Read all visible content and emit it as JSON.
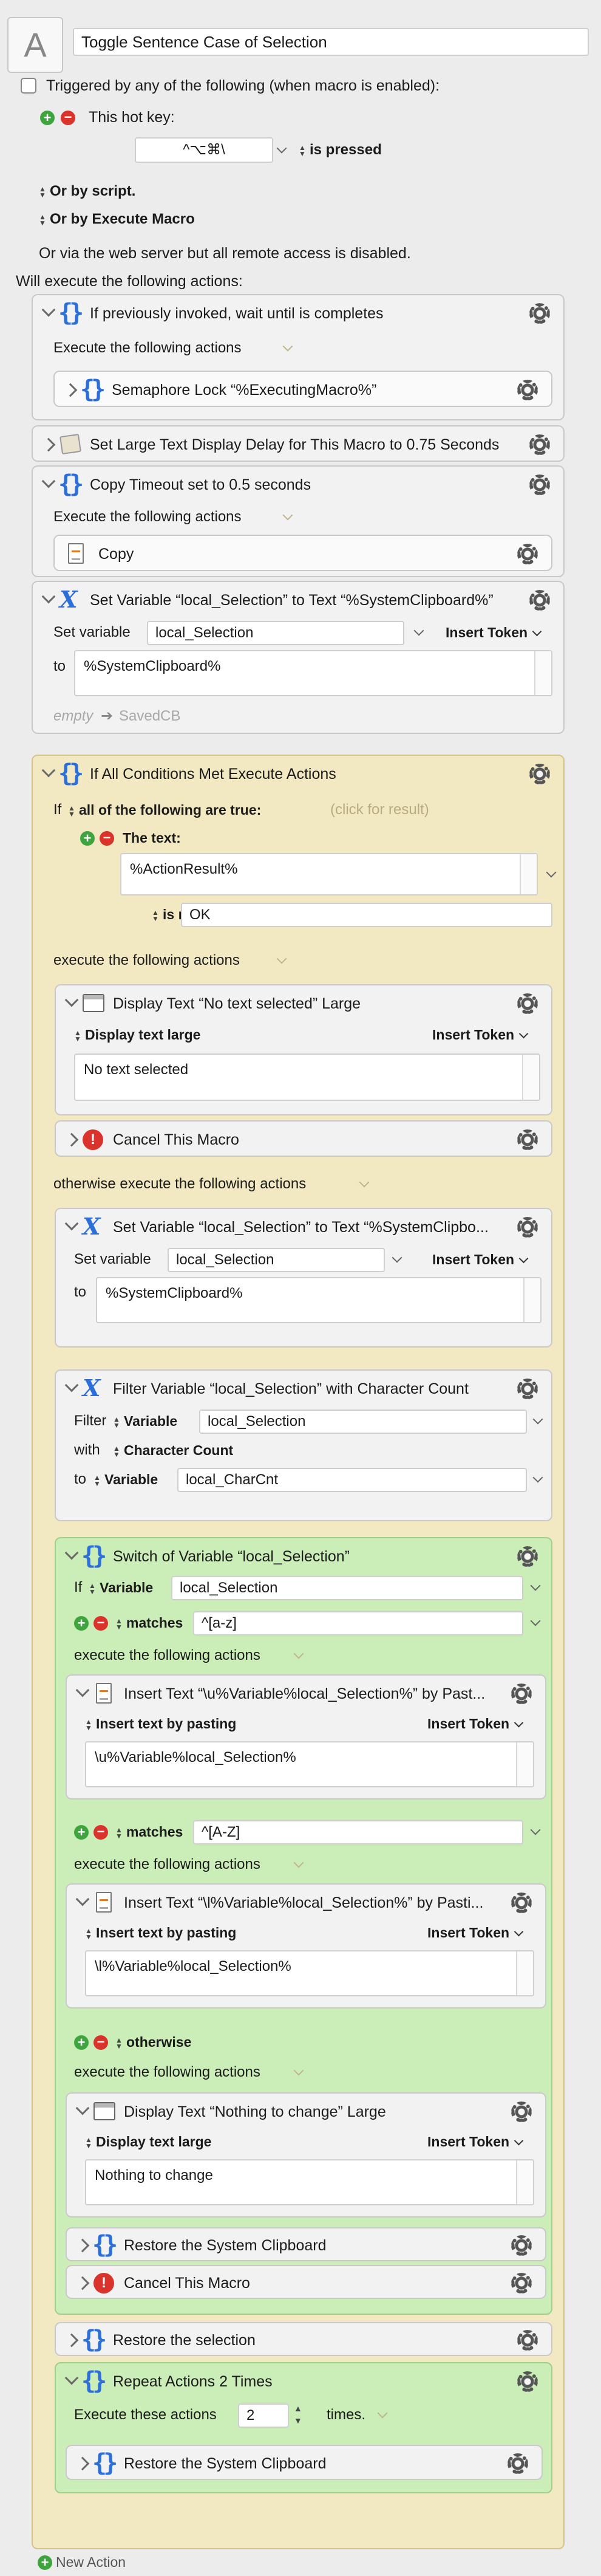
{
  "macro": {
    "title": "Toggle Sentence Case of Selection",
    "icon_letter": "A",
    "trigger_checkbox_label": "Triggered by any of the following (when macro is enabled):",
    "hotkey_label": "This hot key:",
    "hotkey_value": "^⌥⌘\\",
    "hotkey_state": "is pressed",
    "or_by_script": "Or by script.",
    "or_by_execute": "Or by Execute Macro",
    "web_server_note": "Or via the web server but all remote access is disabled.",
    "will_execute": "Will execute the following actions:"
  },
  "actions": {
    "if_previously": {
      "title": "If previously invoked, wait until is completes",
      "exec_label": "Execute the following actions"
    },
    "semaphore": {
      "title": "Semaphore Lock “%ExecutingMacro%”"
    },
    "large_text_delay": {
      "title": "Set Large Text Display Delay for This Macro to 0.75 Seconds"
    },
    "copy_timeout": {
      "title": "Copy Timeout set to 0.5 seconds",
      "exec_label": "Execute the following actions"
    },
    "copy": {
      "title": "Copy"
    },
    "set_var1": {
      "title": "Set Variable “local_Selection” to Text “%SystemClipboard%”",
      "set_label": "Set variable",
      "var_name": "local_Selection",
      "insert_token": "Insert Token",
      "to_label": "to",
      "value": "%SystemClipboard%",
      "empty_label": "empty",
      "saved_label": "SavedCB"
    },
    "if_all": {
      "title": "If All Conditions Met Execute Actions",
      "if_label": "If",
      "all_label": "all of the following are true:",
      "click_result": "(click for result)",
      "the_text": "The text:",
      "text_value": "%ActionResult%",
      "is_not": "is not",
      "is_not_value": "OK",
      "exec_label": "execute the following actions",
      "otherwise_label": "otherwise execute the following actions"
    },
    "display_no_text": {
      "title": "Display Text “No text selected” Large",
      "mode": "Display text large",
      "insert_token": "Insert Token",
      "text": "No text selected"
    },
    "cancel1": {
      "title": "Cancel This Macro"
    },
    "set_var2": {
      "title": "Set Variable “local_Selection” to Text “%SystemClipbo...",
      "set_label": "Set variable",
      "var_name": "local_Selection",
      "insert_token": "Insert Token",
      "to_label": "to",
      "value": "%SystemClipboard%"
    },
    "filter_var": {
      "title": "Filter Variable “local_Selection” with Character Count",
      "filter_label": "Filter",
      "variable_label": "Variable",
      "var_name": "local_Selection",
      "with_label": "with",
      "filter_name": "Character Count",
      "to_label": "to",
      "to_var": "local_CharCnt"
    },
    "switch": {
      "title": "Switch of Variable “local_Selection”",
      "if_label": "If",
      "variable_label": "Variable",
      "var_name": "local_Selection",
      "matches_label": "matches",
      "pattern1": "^[a-z]",
      "exec_label": "execute the following actions",
      "pattern2": "^[A-Z]",
      "otherwise_label": "otherwise"
    },
    "insert_u": {
      "title": "Insert Text “\\u%Variable%local_Selection%” by Past...",
      "mode": "Insert text by pasting",
      "insert_token": "Insert Token",
      "text": "\\u%Variable%local_Selection%"
    },
    "insert_l": {
      "title": "Insert Text “\\l%Variable%local_Selection%” by Pasti...",
      "mode": "Insert text by pasting",
      "insert_token": "Insert Token",
      "text": "\\l%Variable%local_Selection%"
    },
    "display_nothing": {
      "title": "Display Text “Nothing to change” Large",
      "mode": "Display text large",
      "insert_token": "Insert Token",
      "text": "Nothing to change"
    },
    "restore_clip1": {
      "title": "Restore the System Clipboard"
    },
    "cancel2": {
      "title": "Cancel This Macro"
    },
    "restore_sel": {
      "title": "Restore the selection"
    },
    "repeat": {
      "title": "Repeat Actions 2 Times",
      "exec_label": "Execute these actions",
      "count": "2",
      "times_label": "times."
    },
    "restore_clip2": {
      "title": "Restore the System Clipboard"
    }
  },
  "footer": {
    "new_action": "New Action"
  },
  "colors": {
    "accent_blue": "#2d6fd8",
    "if_yellow": "#f2e9c2",
    "switch_green": "#cbeeb9",
    "cancel_red": "#d9332b",
    "add_green": "#3ea53e"
  }
}
